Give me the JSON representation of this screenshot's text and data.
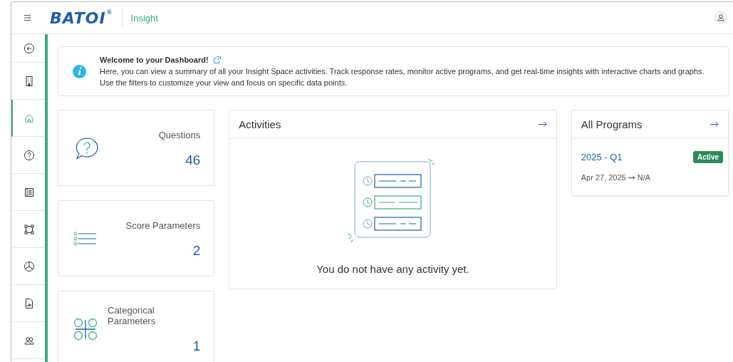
{
  "header": {
    "logo": "BATOI",
    "logo_mark": "®",
    "app_name": "Insight"
  },
  "sidebar": {
    "items": [
      {
        "kind": "back",
        "selected": false
      },
      {
        "kind": "building",
        "selected": false
      },
      {
        "kind": "home",
        "selected": true
      },
      {
        "kind": "help",
        "selected": false
      },
      {
        "kind": "list",
        "selected": false
      },
      {
        "kind": "nodes",
        "selected": false
      },
      {
        "kind": "pie",
        "selected": false
      },
      {
        "kind": "report",
        "selected": false
      },
      {
        "kind": "users",
        "selected": false
      }
    ]
  },
  "welcome": {
    "title": "Welcome to your Dashboard!",
    "lines": [
      "Here, you can view a summary of all your Insight Space activities. Track response rates, monitor active programs, and get real-time insights with interactive charts and graphs.",
      "Use the filters to customize your view and focus on specific data points."
    ]
  },
  "stats": [
    {
      "kind": "question",
      "label": "Questions",
      "value": "46"
    },
    {
      "kind": "checklist",
      "label": "Score Parameters",
      "value": "2"
    },
    {
      "kind": "grid",
      "label": "Categorical Parameters",
      "value": "1"
    }
  ],
  "activities": {
    "title": "Activities",
    "empty_text": "You do not have any activity yet."
  },
  "programs": {
    "title": "All Programs",
    "items": [
      {
        "name": "2025 - Q1",
        "status": "Active",
        "start": "Apr 27, 2025",
        "end": "N/A"
      }
    ]
  }
}
